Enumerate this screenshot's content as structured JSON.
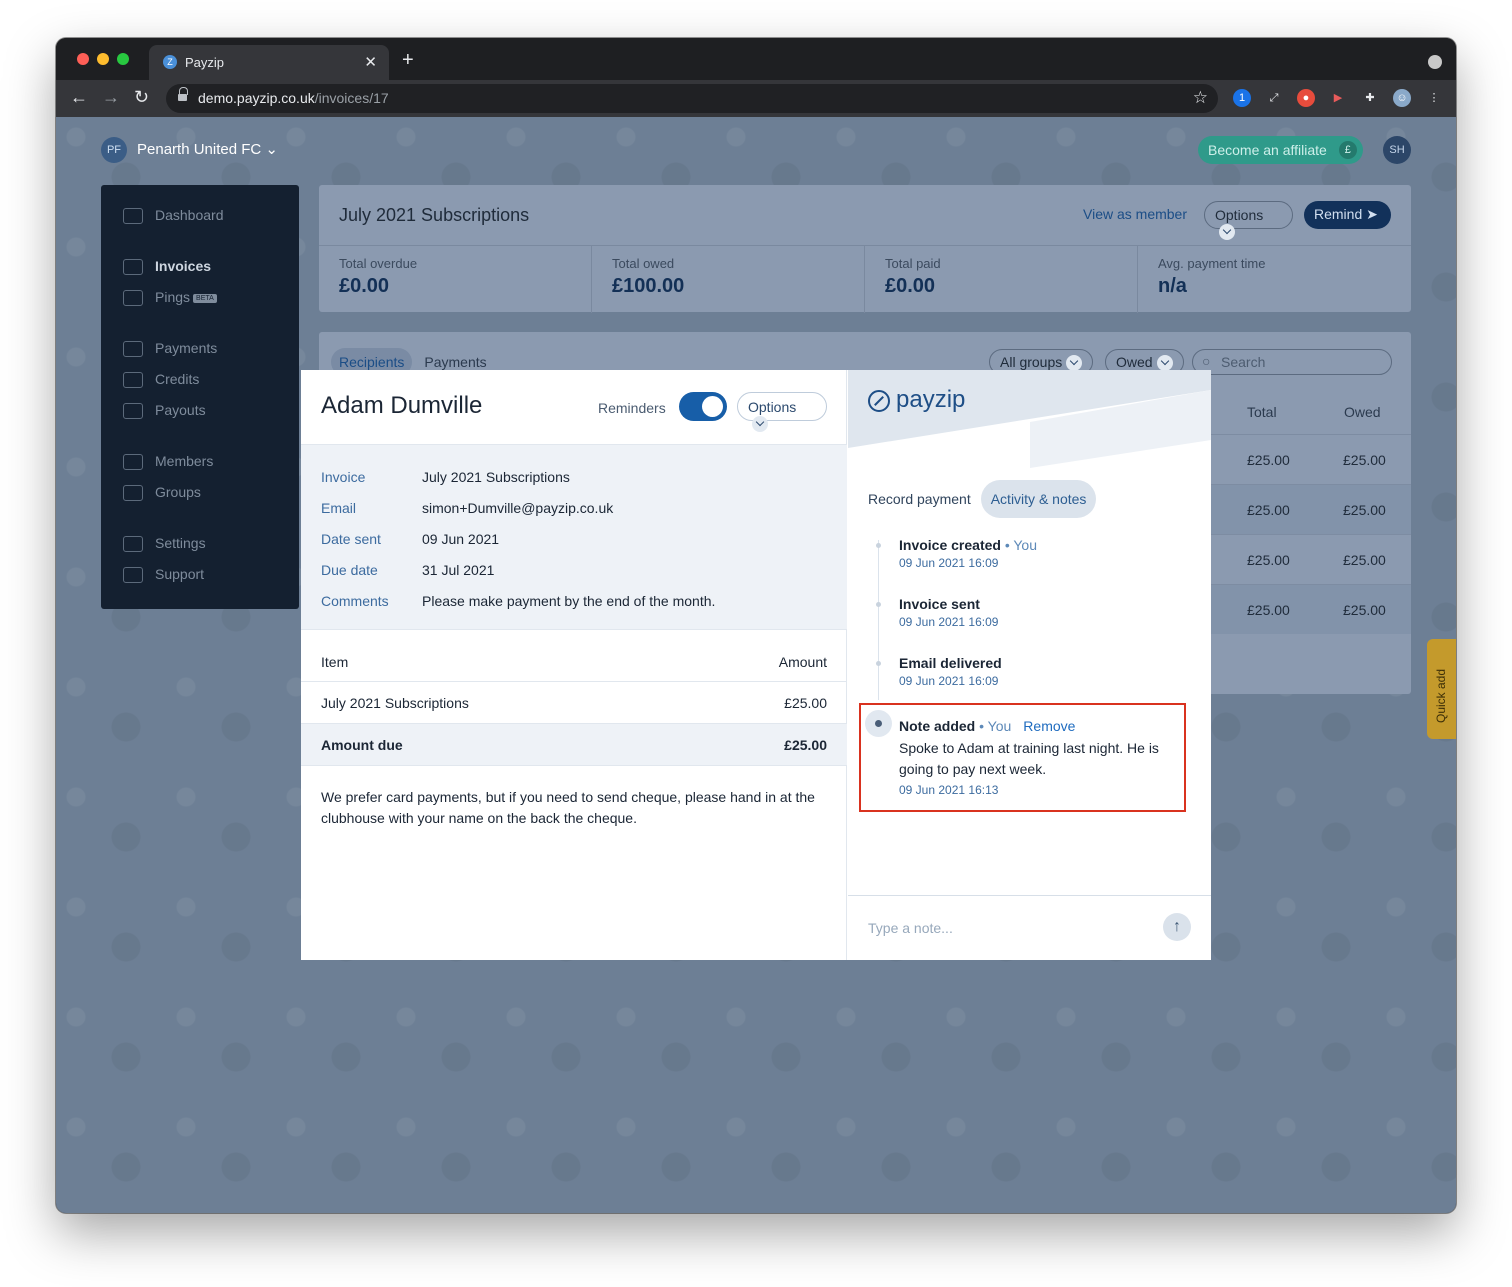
{
  "browser": {
    "tab_title": "Payzip",
    "tab_favicon": "Z",
    "url_host": "demo.payzip.co.uk",
    "url_path": "/invoices/17"
  },
  "topbar": {
    "org_initials": "PF",
    "org_name": "Penarth United FC",
    "affiliate_label": "Become an affiliate",
    "affiliate_icon": "£",
    "user_initials": "SH"
  },
  "sidebar": {
    "items": [
      {
        "label": "Dashboard"
      },
      {
        "label": "Invoices"
      },
      {
        "label": "Pings",
        "badge": "BETA"
      },
      {
        "label": "Payments"
      },
      {
        "label": "Credits"
      },
      {
        "label": "Payouts"
      },
      {
        "label": "Members"
      },
      {
        "label": "Groups"
      },
      {
        "label": "Settings"
      },
      {
        "label": "Support"
      }
    ]
  },
  "invoice_header": {
    "title": "July 2021 Subscriptions",
    "view_as_member": "View as member",
    "options": "Options",
    "remind": "Remind",
    "stats": [
      {
        "label": "Total overdue",
        "value": "£0.00"
      },
      {
        "label": "Total owed",
        "value": "£100.00"
      },
      {
        "label": "Total paid",
        "value": "£0.00"
      },
      {
        "label": "Avg. payment time",
        "value": "n/a"
      }
    ]
  },
  "recipients_table": {
    "tabs": [
      "Recipients",
      "Payments"
    ],
    "filters": [
      "All groups",
      "Owed"
    ],
    "search_placeholder": "Search",
    "columns": [
      "Total",
      "Owed"
    ],
    "rows": [
      {
        "total": "£25.00",
        "owed": "£25.00"
      },
      {
        "total": "£25.00",
        "owed": "£25.00"
      },
      {
        "total": "£25.00",
        "owed": "£25.00"
      },
      {
        "total": "£25.00",
        "owed": "£25.00"
      }
    ]
  },
  "quick_add": "Quick add",
  "modal": {
    "name": "Adam Dumville",
    "reminders_label": "Reminders",
    "reminders_on": true,
    "options_label": "Options",
    "details": [
      {
        "key": "Invoice",
        "value": "July 2021 Subscriptions"
      },
      {
        "key": "Email",
        "value": "simon+Dumville@payzip.co.uk"
      },
      {
        "key": "Date sent",
        "value": "09 Jun 2021"
      },
      {
        "key": "Due date",
        "value": "31 Jul 2021"
      },
      {
        "key": "Comments",
        "value": "Please make payment by the end of the month."
      }
    ],
    "items_header": {
      "item": "Item",
      "amount": "Amount"
    },
    "item_row": {
      "item": "July 2021 Subscriptions",
      "amount": "£25.00"
    },
    "amount_due": {
      "label": "Amount due",
      "amount": "£25.00"
    },
    "footnote": "We prefer card payments, but if you need to send cheque, please hand in at the clubhouse with your name on the back the cheque.",
    "logo_text": "payzip",
    "right_tabs": [
      "Record payment",
      "Activity & notes"
    ],
    "activity": [
      {
        "title": "Invoice created",
        "by": "• You",
        "time": "09 Jun 2021 16:09"
      },
      {
        "title": "Invoice sent",
        "time": "09 Jun 2021 16:09"
      },
      {
        "title": "Email delivered",
        "time": "09 Jun 2021 16:09"
      }
    ],
    "note": {
      "title": "Note added",
      "by": "• You",
      "remove": "Remove",
      "body": "Spoke to Adam at training last night. He is going to pay next week.",
      "time": "09 Jun 2021 16:13"
    },
    "note_placeholder": "Type a note...",
    "send_icon": "↑"
  },
  "colors": {
    "brand": "#1e4e86",
    "toggle": "#175ea8",
    "highlight": "#d9321f",
    "affiliate": "#2f9a8a"
  }
}
